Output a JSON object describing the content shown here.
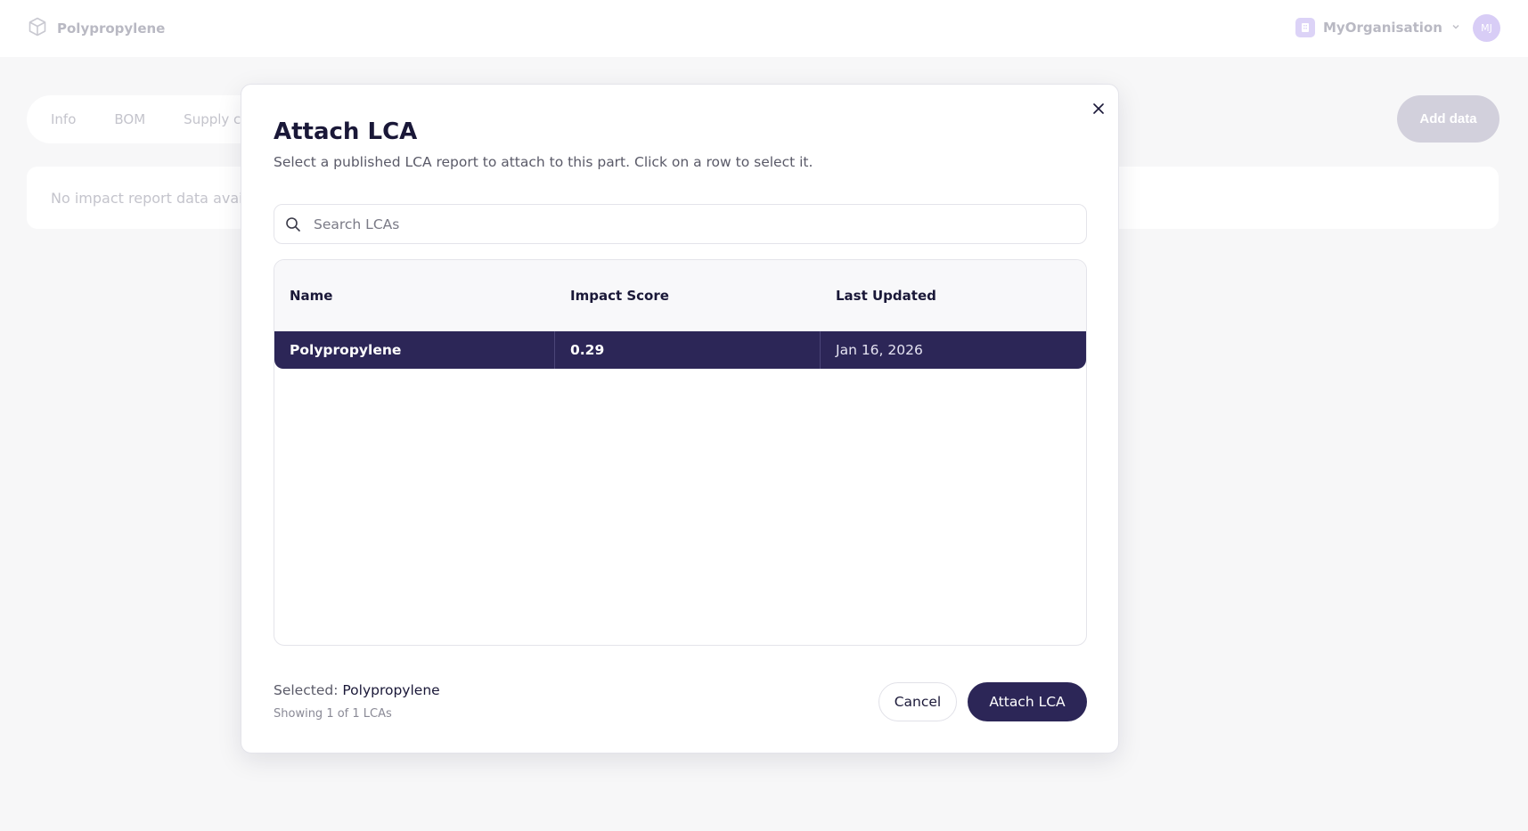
{
  "header": {
    "brand_name": "Polypropylene",
    "brand_icon": "cube-icon",
    "org_name": "MyOrganisation",
    "org_icon": "building-icon",
    "avatar_initials": "MJ"
  },
  "tabs": [
    {
      "label": "Info"
    },
    {
      "label": "BOM"
    },
    {
      "label": "Supply ch"
    }
  ],
  "actions": {
    "add_data_label": "Add data"
  },
  "empty_state": {
    "text": "No impact report data availab"
  },
  "modal": {
    "title": "Attach LCA",
    "description": "Select a published LCA report to attach to this part. Click on a row to select it.",
    "search_placeholder": "Search LCAs",
    "table": {
      "columns": [
        "Name",
        "Impact Score",
        "Last Updated"
      ],
      "rows": [
        {
          "name": "Polypropylene",
          "impact_score": "0.29",
          "last_updated": "Jan 16, 2026",
          "selected": true
        }
      ]
    },
    "selected_label": "Selected:",
    "selected_value": "Polypropylene",
    "showing_text": "Showing 1 of 1 LCAs",
    "cancel_label": "Cancel",
    "attach_label": "Attach LCA"
  },
  "colors": {
    "primary": "#2c2657",
    "background": "#f7f7f8",
    "muted_text": "#c4c4cc"
  }
}
